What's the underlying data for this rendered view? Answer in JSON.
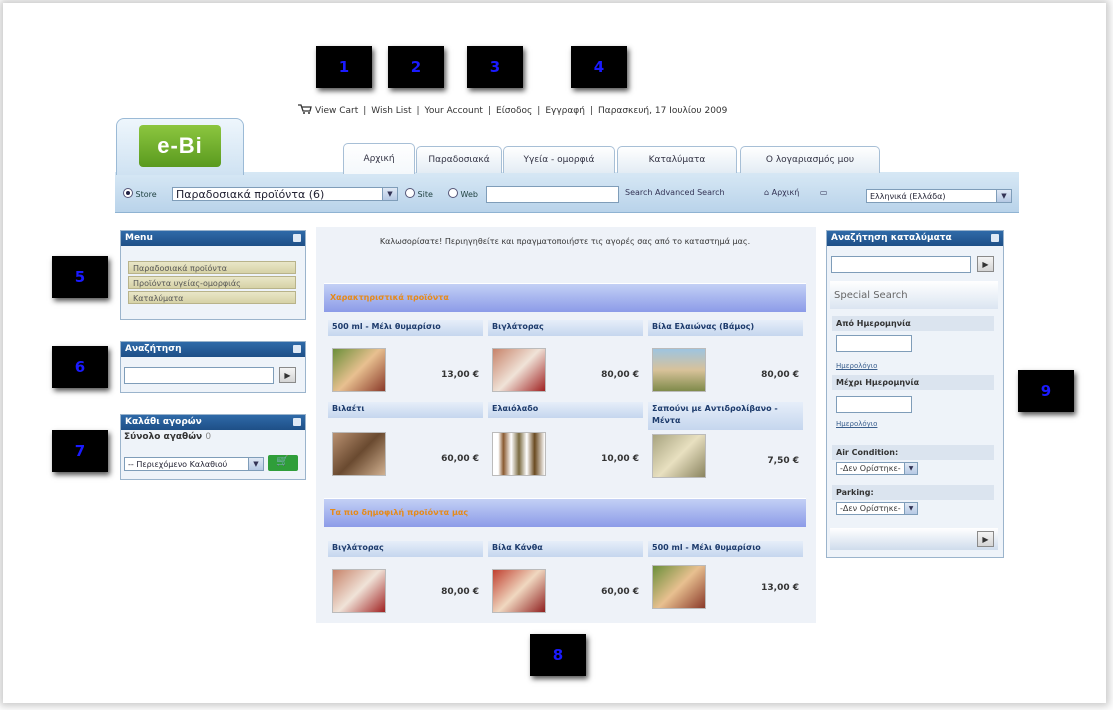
{
  "markers": [
    "1",
    "2",
    "3",
    "4",
    "5",
    "6",
    "7",
    "8",
    "9"
  ],
  "top_links": {
    "view_cart": "View Cart",
    "wish_list": "Wish List",
    "your_account": "Your Account",
    "login": "Είσοδος",
    "register": "Εγγραφή",
    "date": "Παρασκευή, 17 Ιουλίου 2009",
    "sep": "|"
  },
  "logo": {
    "text": "e-Bi"
  },
  "tabs": [
    "Αρχική",
    "Παραδοσιακά",
    "Υγεία - ομορφιά",
    "Καταλύματα",
    "Ο λογαριασμός μου"
  ],
  "search_bar": {
    "store_label": "Store",
    "category_select": "Παραδοσιακά προϊόντα (6)",
    "site_label": "Site",
    "web_label": "Web",
    "search_link": "Search",
    "advanced_link": "Advanced Search",
    "home_link": "Αρχική",
    "language_select": "Ελληνικά (Ελλάδα)"
  },
  "menu_panel": {
    "title": "Menu",
    "items": [
      "Παραδοσιακά προϊόντα",
      "Προϊόντα υγείας-ομορφιάς",
      "Καταλύματα"
    ]
  },
  "search_panel": {
    "title": "Αναζήτηση"
  },
  "basket_panel": {
    "title": "Καλάθι αγορών",
    "total_label": "Σύνολο αγαθών",
    "total_value": "0",
    "select": "-- Περιεχόμενο Καλαθιού"
  },
  "main": {
    "welcome": "Καλωσορίσατε! Περιηγηθείτε και πραγματοποιήστε τις αγορές σας από το καταστημά μας.",
    "section1_title": "Χαρακτηριστικά προϊόντα",
    "section2_title": "Τα πιο δημοφιλή προϊόντα μας",
    "products1": [
      {
        "name": "500 ml - Μέλι θυμαρίσιο",
        "price": "13,00 €"
      },
      {
        "name": "Βιγλάτορας",
        "price": "80,00 €"
      },
      {
        "name": "Βίλα Ελαιώνας (Βάμος)",
        "price": "80,00 €"
      },
      {
        "name": "Βιλαέτι",
        "price": "60,00 €"
      },
      {
        "name": "Ελαιόλαδο",
        "price": "10,00 €"
      },
      {
        "name": "Σαπούνι με Αντιδρολίβανο - Μέντα",
        "price": "7,50 €"
      }
    ],
    "products2": [
      {
        "name": "Βιγλάτορας",
        "price": "80,00 €"
      },
      {
        "name": "Βίλα Κάνθα",
        "price": "60,00 €"
      },
      {
        "name": "500 ml - Μέλι θυμαρίσιο",
        "price": "13,00 €"
      }
    ]
  },
  "right_panel": {
    "title": "Αναζήτηση καταλύματα",
    "special_search": "Special Search",
    "from_date": "Από Ημερομηνία",
    "calendar_link": "Ημερολόγιο",
    "to_date": "Μέχρι Ημερομηνία",
    "air_condition": "Air Condition:",
    "parking": "Parking:",
    "any_option": "-Δεν Ορίστηκε-"
  },
  "colors": {
    "marker_text": "#1a1aff",
    "header_blue": "#1e4f87",
    "section_orange": "#e58a1a"
  }
}
